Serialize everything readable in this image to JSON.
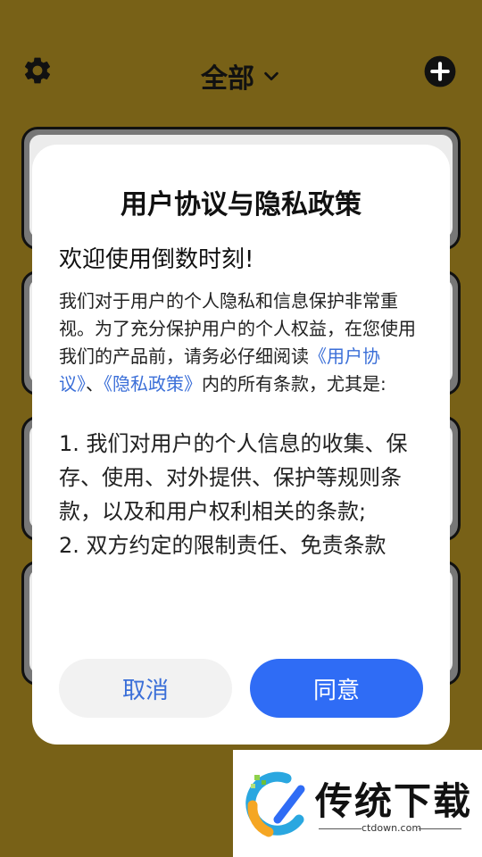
{
  "header": {
    "title": "全部",
    "settings_icon": "gear-icon",
    "dropdown_icon": "chevron-down-icon",
    "add_icon": "plus-circle-icon"
  },
  "dialog": {
    "title": "用户协议与隐私政策",
    "welcome": "欢迎使用倒数时刻!",
    "intro_part1": "我们对于用户的个人隐私和信息保护非常重视。为了充分保护用户的个人权益，在您使用我们的产品前，请务必仔细阅读",
    "link_user_agreement": "《用户协议》",
    "separator": "、",
    "link_privacy_policy": "《隐私政策》",
    "intro_part2": "内的所有条款，尤其是:",
    "term1": "1. 我们对用户的个人信息的收集、保存、使用、对外提供、保护等规则条款，以及和用户权利相关的条款;",
    "term2": "2. 双方约定的限制责任、免责条款",
    "cancel_label": "取消",
    "agree_label": "同意"
  },
  "watermark": {
    "brand": "传统下载",
    "url": "ctdown.com"
  },
  "colors": {
    "background": "#786117",
    "link": "#3b6fd8",
    "primary_button": "#2f6cf5"
  }
}
